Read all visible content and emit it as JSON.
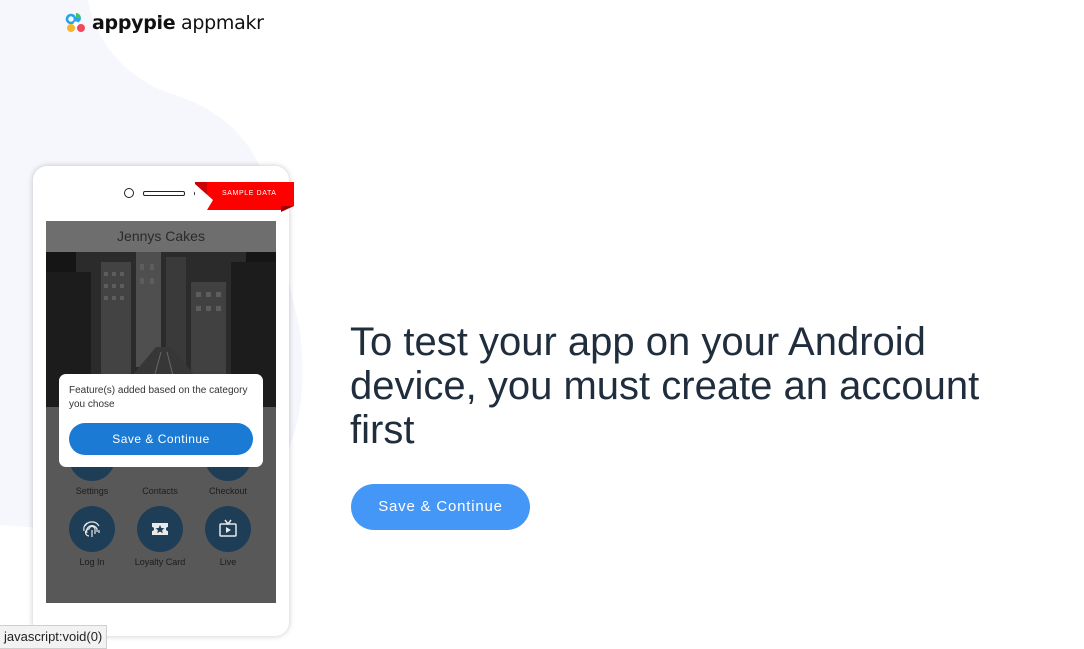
{
  "brand": {
    "name_bold": "appypie",
    "name_regular": " appmakr"
  },
  "phone": {
    "ribbon_label": "SAMPLE DATA",
    "app_title": "Jennys Cakes",
    "popup": {
      "message": "Feature(s) added based on the category you chose",
      "button_label": "Save & Continue"
    },
    "features_row1": [
      {
        "label": "Settings"
      },
      {
        "label": "Contacts"
      },
      {
        "label": "Checkout"
      }
    ],
    "features_row2": [
      {
        "label": "Log In",
        "icon": "fingerprint-icon"
      },
      {
        "label": "Loyalty Card",
        "icon": "loyalty-card-icon"
      },
      {
        "label": "Live",
        "icon": "live-tv-icon"
      }
    ]
  },
  "main": {
    "headline": "To test your app on your Android device, you must create an account first",
    "cta_label": "Save & Continue"
  },
  "statusbar": {
    "text": "javascript:void(0)"
  },
  "colors": {
    "cta": "#4497f6",
    "popup_button": "#1b7ad3",
    "ribbon": "#ff0000",
    "feature_circle": "#1e3d57",
    "headline": "#1f2d3d"
  }
}
